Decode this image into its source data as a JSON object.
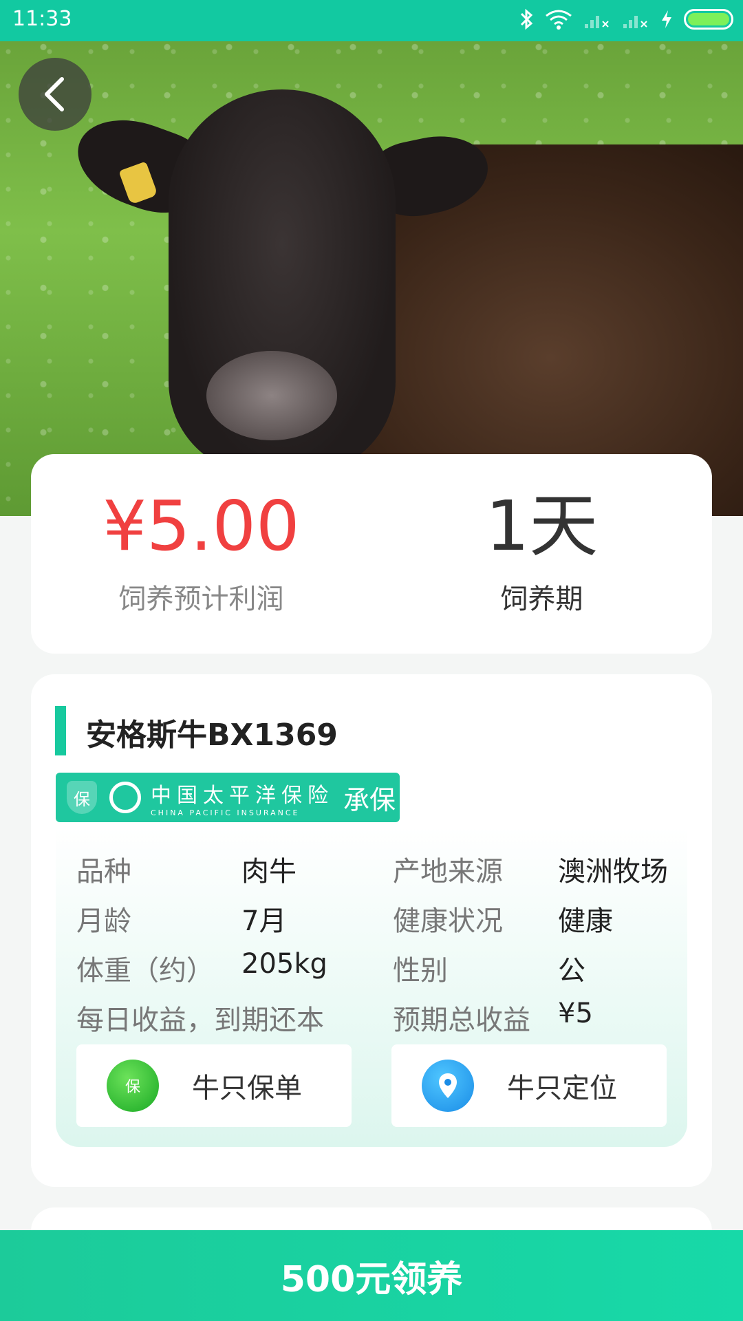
{
  "status_bar": {
    "time": "11:33"
  },
  "stats": {
    "profit_value": "¥5.00",
    "profit_label": "饲养预计利润",
    "period_value": "1天",
    "period_label": "饲养期"
  },
  "product": {
    "title": "安格斯牛BX1369",
    "insurance_cn": "中国太平洋保险",
    "insurance_en": "CHINA PACIFIC INSURANCE",
    "insurance_tag": "承保",
    "insurance_shield": "保"
  },
  "details": [
    {
      "label1": "品种",
      "value1": "肉牛",
      "label2": "产地来源",
      "value2": "澳洲牧场"
    },
    {
      "label1": "月龄",
      "value1": "7月",
      "label2": "健康状况",
      "value2": "健康"
    },
    {
      "label1": "体重（约）",
      "value1": "205kg",
      "label2": "性别",
      "value2": "公"
    },
    {
      "label1": "每日收益，到期还本",
      "value1": "",
      "label2": "预期总收益",
      "value2": "¥5"
    }
  ],
  "actions": {
    "policy_label": "牛只保单",
    "policy_icon_text": "保",
    "locate_label": "牛只定位"
  },
  "bottom": {
    "adopt_label": "500元领养"
  },
  "colors": {
    "accent": "#12c9a1",
    "profit": "#f04040"
  },
  "icons": [
    "bluetooth-icon",
    "wifi-icon",
    "signal-icon",
    "charging-icon",
    "battery-icon",
    "back-arrow-icon",
    "shield-icon",
    "location-pin-icon"
  ]
}
